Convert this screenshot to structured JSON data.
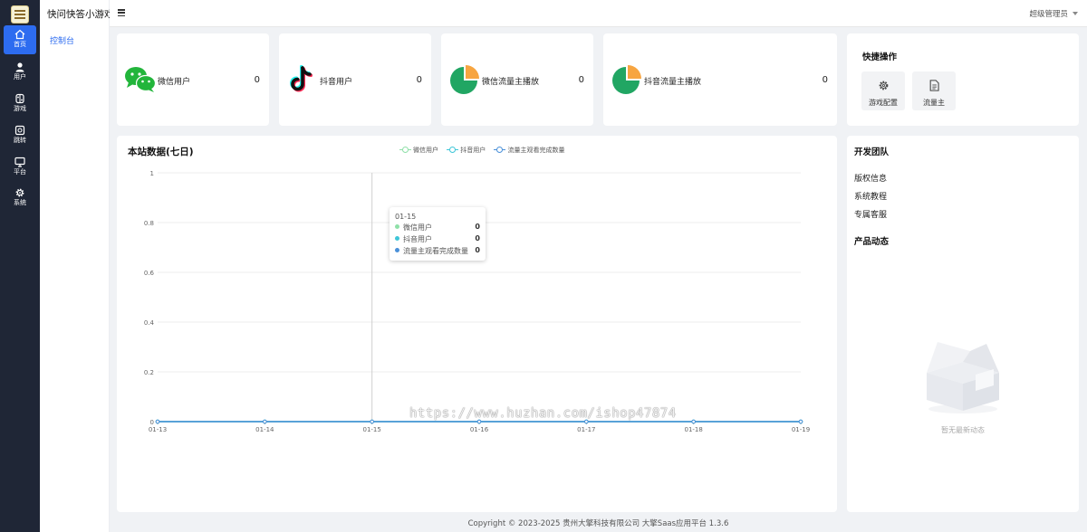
{
  "app": {
    "title": "快问快答小游戏"
  },
  "rail": {
    "items": [
      {
        "label": "首页",
        "icon": "home-icon",
        "active": true
      },
      {
        "label": "用户",
        "icon": "user-icon"
      },
      {
        "label": "游戏",
        "icon": "gamepad-icon"
      },
      {
        "label": "跳转",
        "icon": "link-icon"
      },
      {
        "label": "平台",
        "icon": "monitor-icon"
      },
      {
        "label": "系统",
        "icon": "gear-icon"
      }
    ]
  },
  "subnav": {
    "active_item": "控制台"
  },
  "header": {
    "admin_label": "超级管理员"
  },
  "stats": [
    {
      "label": "微信用户",
      "value": "0",
      "icon": "wechat-icon"
    },
    {
      "label": "抖音用户",
      "value": "0",
      "icon": "douyin-icon"
    },
    {
      "label": "微信流量主播放",
      "value": "0",
      "icon": "pie-icon"
    },
    {
      "label": "抖音流量主播放",
      "value": "0",
      "icon": "pie-icon"
    }
  ],
  "quick_actions": {
    "title": "快捷操作",
    "buttons": [
      {
        "label": "游戏配置",
        "icon": "gear-icon"
      },
      {
        "label": "流量主",
        "icon": "document-icon"
      }
    ]
  },
  "dev_team": {
    "title": "开发团队",
    "links": [
      "版权信息",
      "系统教程",
      "专属客服"
    ]
  },
  "product_news": {
    "title": "产品动态",
    "empty_text": "暂无最新动态"
  },
  "chart_section": {
    "title": "本站数据(七日)"
  },
  "chart_data": {
    "type": "line",
    "title": "本站数据(七日)",
    "categories": [
      "01-13",
      "01-14",
      "01-15",
      "01-16",
      "01-17",
      "01-18",
      "01-19"
    ],
    "series": [
      {
        "name": "微信用户",
        "color": "#8fe0a8",
        "values": [
          0,
          0,
          0,
          0,
          0,
          0,
          0
        ]
      },
      {
        "name": "抖音用户",
        "color": "#3ec6d8",
        "values": [
          0,
          0,
          0,
          0,
          0,
          0,
          0
        ]
      },
      {
        "name": "流量主观看完成数量",
        "color": "#4a90d9",
        "values": [
          0,
          0,
          0,
          0,
          0,
          0,
          0
        ]
      }
    ],
    "ylim": [
      0,
      1
    ],
    "yticks": [
      "0",
      "0.2",
      "0.4",
      "0.6",
      "0.8",
      "1"
    ],
    "grid": true,
    "legend": "top-center"
  },
  "tooltip": {
    "title": "01-15",
    "rows": [
      {
        "name": "微信用户",
        "value": "0",
        "color": "#8fe0a8"
      },
      {
        "name": "抖音用户",
        "value": "0",
        "color": "#3ec6d8"
      },
      {
        "name": "流量主观看完成数量",
        "value": "0",
        "color": "#4a90d9"
      }
    ]
  },
  "watermark": "https://www.huzhan.com/ishop47874",
  "footer": {
    "text": "Copyright © 2023-2025 贵州大擎科技有限公司  大擎Saas应用平台 1.3.6"
  },
  "colors": {
    "accent": "#2d6cf0",
    "rail_bg": "#1f2636",
    "pie_green": "#21a663",
    "pie_orange": "#f7a541"
  }
}
